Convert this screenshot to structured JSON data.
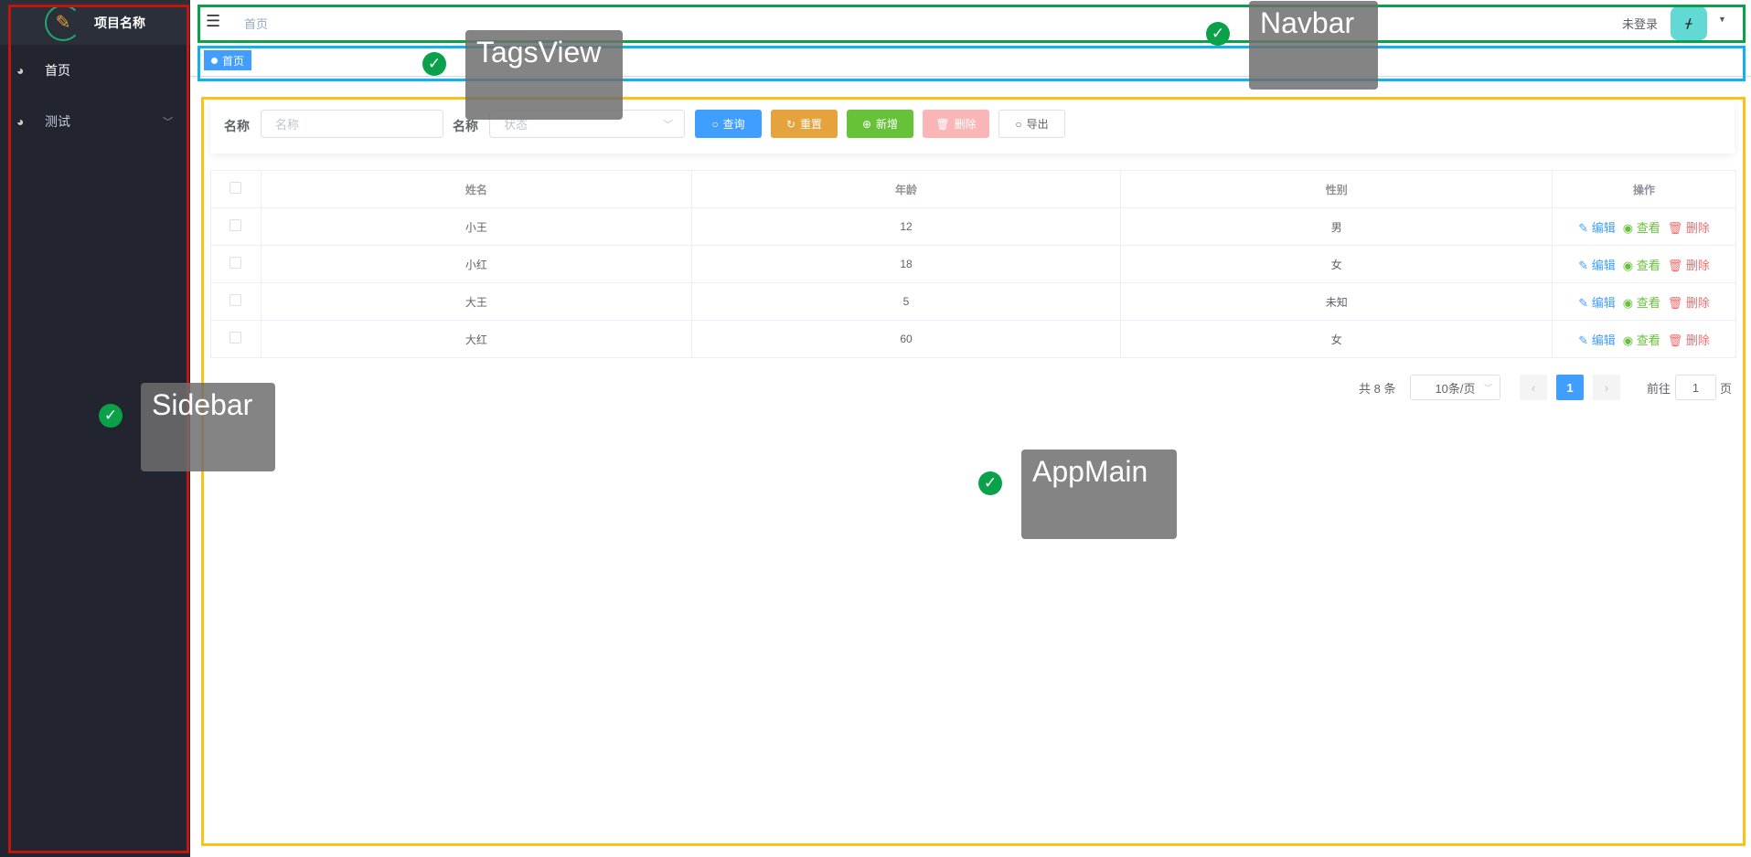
{
  "sidebar": {
    "title": "项目名称",
    "items": [
      {
        "label": "首页",
        "icon": "dashboard-icon"
      },
      {
        "label": "测试",
        "icon": "dashboard-icon"
      }
    ]
  },
  "navbar": {
    "breadcrumb": "首页",
    "user": "未登录"
  },
  "tags": {
    "items": [
      "首页"
    ]
  },
  "search": {
    "label1": "名称",
    "placeholder1": "名称",
    "label2": "名称",
    "placeholder2": "状态",
    "buttons": {
      "query": "查询",
      "reset": "重置",
      "add": "新增",
      "delete": "删除",
      "export": "导出"
    }
  },
  "table": {
    "headers": [
      "姓名",
      "年龄",
      "性别",
      "操作"
    ],
    "rows": [
      {
        "name": "小王",
        "age": "12",
        "gender": "男"
      },
      {
        "name": "小红",
        "age": "18",
        "gender": "女"
      },
      {
        "name": "大王",
        "age": "5",
        "gender": "未知"
      },
      {
        "name": "大红",
        "age": "60",
        "gender": "女"
      }
    ],
    "ops": {
      "edit": "编辑",
      "view": "查看",
      "delete": "删除"
    }
  },
  "pagination": {
    "total": "共 8 条",
    "page_size": "10条/页",
    "current": "1",
    "goto_label": "前往",
    "goto_value": "1",
    "page_suffix": "页"
  },
  "annotations": {
    "navbar": "Navbar",
    "tagsview": "TagsView",
    "sidebar": "Sidebar",
    "appmain": "AppMain"
  },
  "colors": {
    "primary": "#409eff",
    "warning": "#e6a23c",
    "success": "#67c23a",
    "danger": "#f56c6c"
  }
}
